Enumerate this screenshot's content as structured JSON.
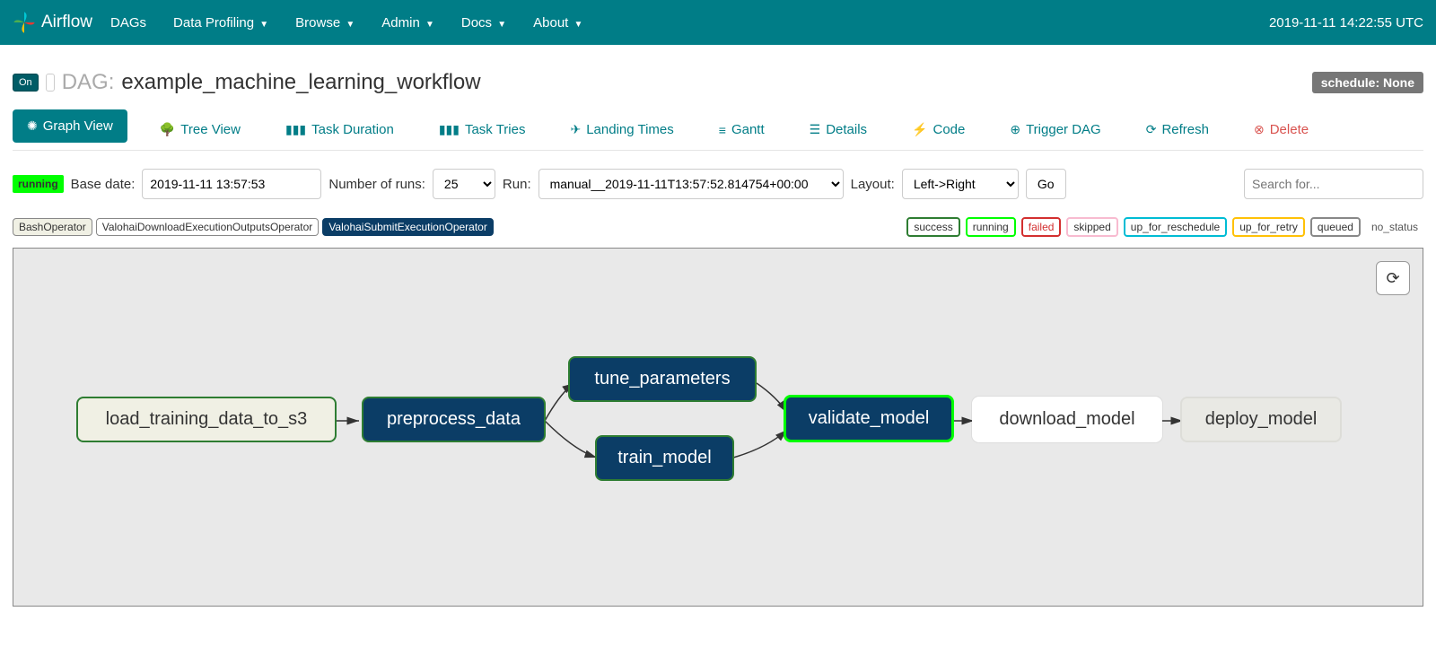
{
  "navbar": {
    "brand": "Airflow",
    "links": [
      "DAGs",
      "Data Profiling",
      "Browse",
      "Admin",
      "Docs",
      "About"
    ],
    "clock": "2019-11-11 14:22:55 UTC"
  },
  "header": {
    "toggle": "On",
    "dag_label": "DAG:",
    "dag_name": "example_machine_learning_workflow",
    "schedule": "schedule: None"
  },
  "tabs": {
    "graph_view": "Graph View",
    "tree_view": "Tree View",
    "task_duration": "Task Duration",
    "task_tries": "Task Tries",
    "landing_times": "Landing Times",
    "gantt": "Gantt",
    "details": "Details",
    "code": "Code",
    "trigger": "Trigger DAG",
    "refresh": "Refresh",
    "delete": "Delete"
  },
  "filters": {
    "status": "running",
    "base_date_label": "Base date:",
    "base_date_value": "2019-11-11 13:57:53",
    "num_runs_label": "Number of runs:",
    "num_runs_value": "25",
    "run_label": "Run:",
    "run_value": "manual__2019-11-11T13:57:52.814754+00:00",
    "layout_label": "Layout:",
    "layout_value": "Left->Right",
    "go": "Go",
    "search_placeholder": "Search for..."
  },
  "operators": {
    "bash": "BashOperator",
    "download": "ValohaiDownloadExecutionOutputsOperator",
    "submit": "ValohaiSubmitExecutionOperator"
  },
  "statuses": {
    "success": "success",
    "running": "running",
    "failed": "failed",
    "skipped": "skipped",
    "up_for_reschedule": "up_for_reschedule",
    "up_for_retry": "up_for_retry",
    "queued": "queued",
    "no_status": "no_status"
  },
  "nodes": {
    "load": "load_training_data_to_s3",
    "preprocess": "preprocess_data",
    "tune": "tune_parameters",
    "train": "train_model",
    "validate": "validate_model",
    "download": "download_model",
    "deploy": "deploy_model"
  }
}
